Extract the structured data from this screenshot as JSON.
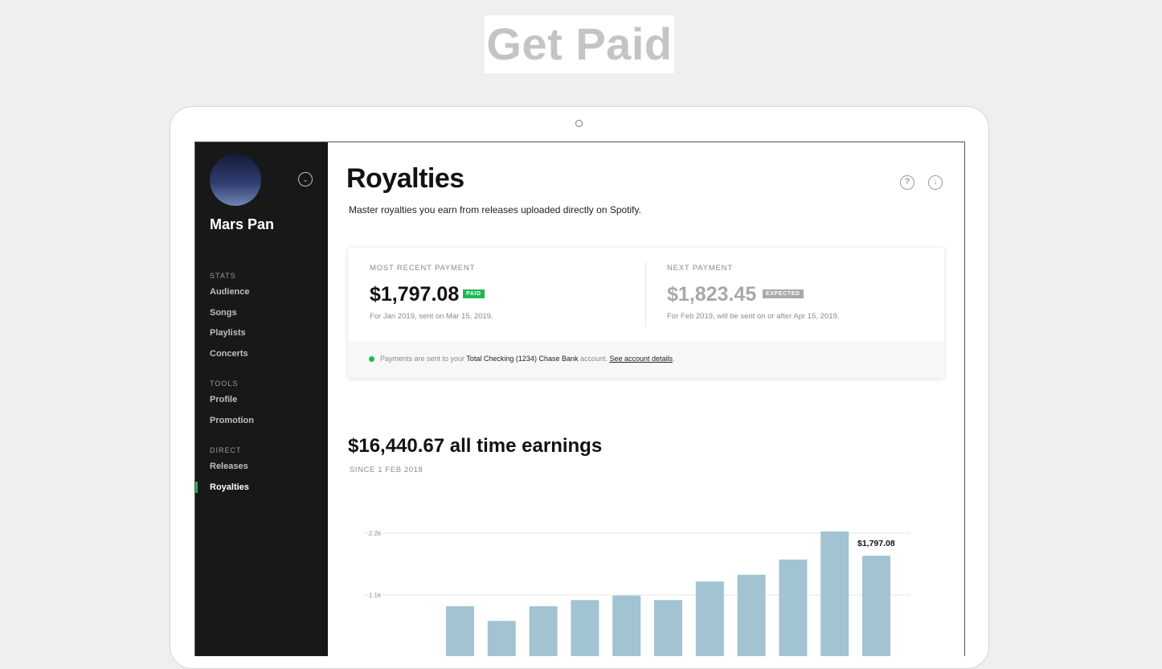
{
  "headline": "Get Paid",
  "sidebar": {
    "user_name": "Mars Pan",
    "sections": [
      {
        "title": "STATS",
        "items": [
          "Audience",
          "Songs",
          "Playlists",
          "Concerts"
        ]
      },
      {
        "title": "TOOLS",
        "items": [
          "Profile",
          "Promotion"
        ]
      },
      {
        "title": "DIRECT",
        "items": [
          "Releases",
          "Royalties"
        ]
      }
    ],
    "active_item": "Royalties"
  },
  "page": {
    "title": "Royalties",
    "subtitle": "Master royalties you earn from releases uploaded directly on Spotify.",
    "help_icon": "question-icon",
    "download_icon": "download-icon"
  },
  "payments": {
    "recent": {
      "label": "MOST RECENT PAYMENT",
      "amount": "$1,797.08",
      "badge": "PAID",
      "badge_color": "#1db954",
      "note": "For Jan 2019, sent on Mar 15, 2019."
    },
    "next": {
      "label": "NEXT PAYMENT",
      "amount": "$1,823.45",
      "badge": "EXPECTED",
      "badge_color": "#a9a9a9",
      "note": "For Feb 2019, will be sent on or after Apr 15, 2019."
    },
    "footer": {
      "prefix": "Payments are sent to your ",
      "account": "Total Checking (1234) Chase Bank",
      "middle": " account. ",
      "link": "See account details",
      "suffix": "."
    }
  },
  "earnings": {
    "title": "$16,440.67 all time earnings",
    "since": "SINCE 1 FEB 2018"
  },
  "chart_data": {
    "type": "bar",
    "ytick_labels": [
      "2.2k",
      "1.1k"
    ],
    "yticks": [
      2200,
      1100
    ],
    "values": [
      900,
      640,
      900,
      1010,
      1090,
      1010,
      1340,
      1460,
      1730,
      2230,
      1797.08
    ],
    "highlight_label": "$1,797.08",
    "bar_color": "#a2c3d2",
    "grid": true
  }
}
